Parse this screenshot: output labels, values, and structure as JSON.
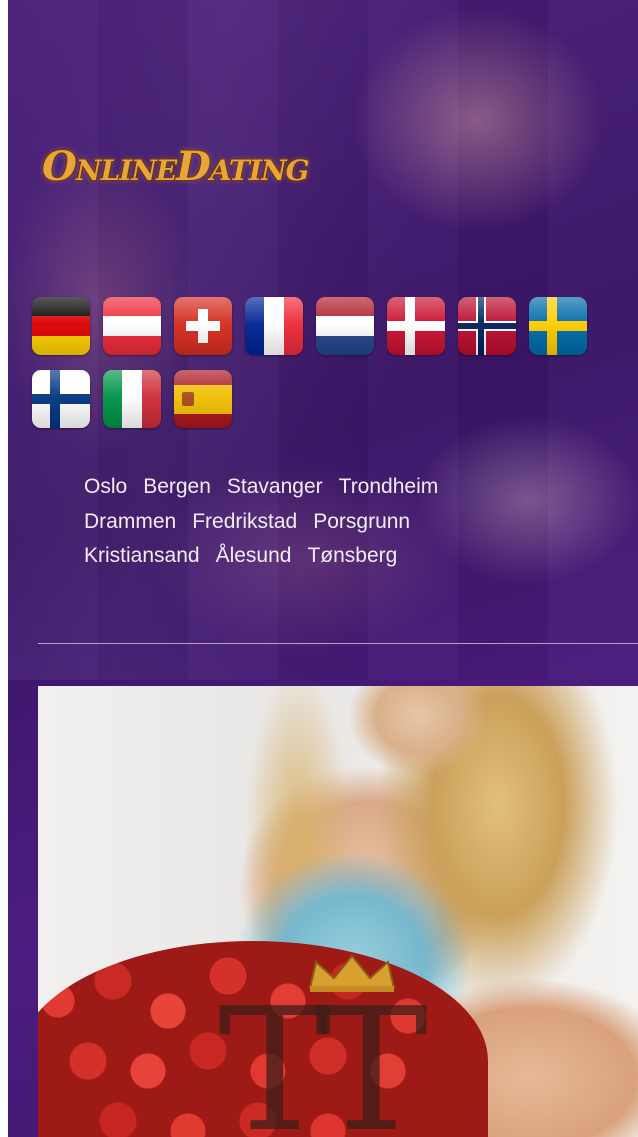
{
  "brand": {
    "logo_text": "OnlineDating"
  },
  "flags": [
    {
      "country": "Germany",
      "icon": "flag-germany-icon",
      "colors": [
        "#000000",
        "#dd0000",
        "#ffce00"
      ]
    },
    {
      "country": "Austria",
      "icon": "flag-austria-icon",
      "colors": [
        "#ed2939",
        "#ffffff",
        "#ed2939"
      ]
    },
    {
      "country": "Switzerland",
      "icon": "flag-switzerland-icon",
      "colors": [
        "#d52b1e",
        "#ffffff"
      ]
    },
    {
      "country": "France",
      "icon": "flag-france-icon",
      "colors": [
        "#002395",
        "#ffffff",
        "#ed2939"
      ]
    },
    {
      "country": "Netherlands",
      "icon": "flag-netherlands-icon",
      "colors": [
        "#ae1c28",
        "#ffffff",
        "#21468b"
      ]
    },
    {
      "country": "Denmark",
      "icon": "flag-denmark-icon",
      "colors": [
        "#c8102e",
        "#ffffff"
      ]
    },
    {
      "country": "Norway",
      "icon": "flag-norway-icon",
      "colors": [
        "#ba0c2f",
        "#ffffff",
        "#00205b"
      ]
    },
    {
      "country": "Sweden",
      "icon": "flag-sweden-icon",
      "colors": [
        "#006aa7",
        "#fecc00"
      ]
    },
    {
      "country": "Finland",
      "icon": "flag-finland-icon",
      "colors": [
        "#ffffff",
        "#003580"
      ]
    },
    {
      "country": "Italy",
      "icon": "flag-italy-icon",
      "colors": [
        "#009246",
        "#ffffff",
        "#ce2b37"
      ]
    },
    {
      "country": "Spain",
      "icon": "flag-spain-icon",
      "colors": [
        "#aa151b",
        "#f1bf00"
      ]
    }
  ],
  "cities": {
    "row1": [
      "Oslo",
      "Bergen",
      "Stavanger",
      "Trondheim"
    ],
    "row2": [
      "Drammen",
      "Fredrikstad",
      "Porsgrunn"
    ],
    "row3": [
      "Kristiansand",
      "Ålesund",
      "Tønsberg"
    ]
  },
  "theme": {
    "background": "#3f1870",
    "link_color": "#f0ecf4",
    "logo_color": "#e8a53a"
  }
}
